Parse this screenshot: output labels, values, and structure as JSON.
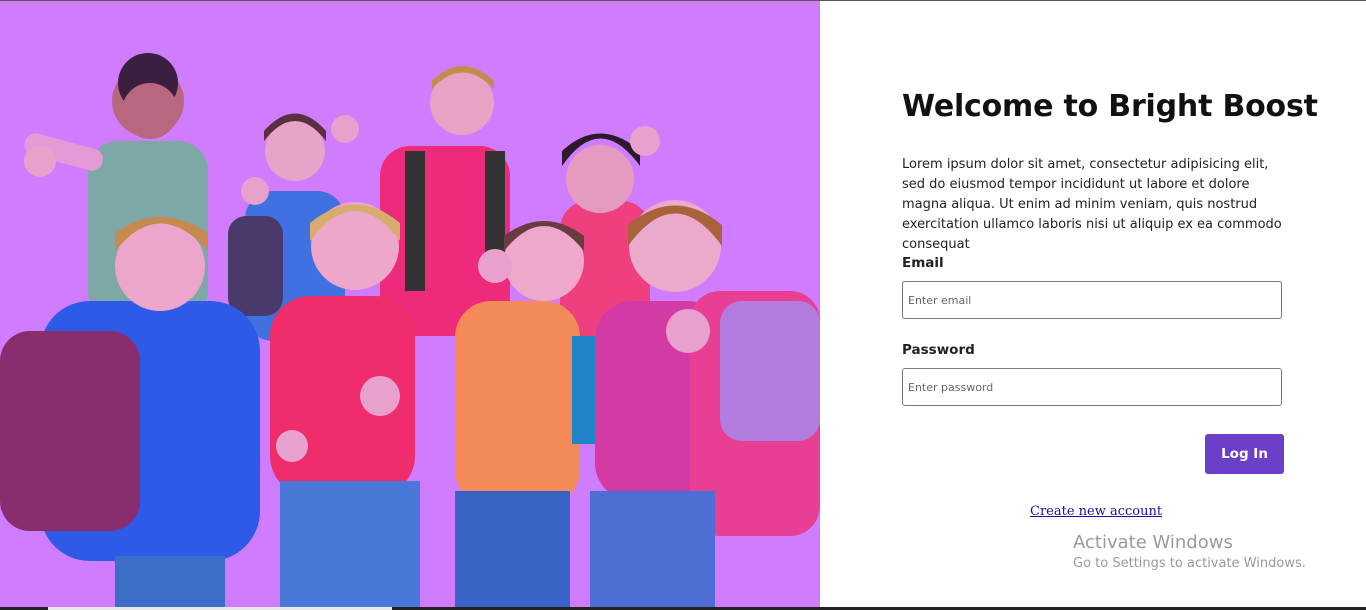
{
  "hero": {
    "image_icon": "children-thumbs-up-photo",
    "overlay_color": "#cf7cff"
  },
  "login": {
    "title": "Welcome to Bright Boost",
    "description": "Lorem ipsum dolor sit amet, consectetur adipisicing elit, sed do eiusmod tempor incididunt ut labore et dolore magna aliqua. Ut enim ad minim veniam, quis nostrud exercitation ullamco laboris nisi ut aliquip ex ea commodo consequat",
    "email_label": "Email",
    "email_placeholder": "Enter email",
    "email_value": "",
    "password_label": "Password",
    "password_placeholder": "Enter password",
    "password_value": "",
    "login_button": "Log In",
    "create_account_link": "Create new account",
    "accent_color": "#6b3fc8"
  },
  "watermark": {
    "line1": "Activate Windows",
    "line2": "Go to Settings to activate Windows."
  }
}
